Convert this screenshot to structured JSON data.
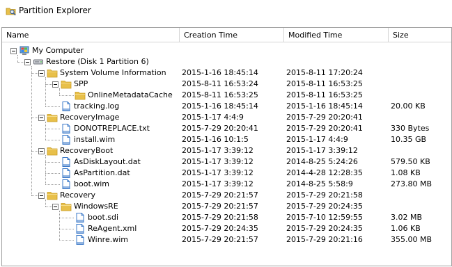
{
  "window": {
    "title": "Partition Explorer",
    "icon": "search-folder-icon"
  },
  "columns": [
    {
      "label": "Name"
    },
    {
      "label": "Creation Time"
    },
    {
      "label": "Modified Time"
    },
    {
      "label": "Size"
    }
  ],
  "rows": [
    {
      "name": "My Computer",
      "level": 0,
      "type": "computer",
      "expanded": true,
      "creation": "",
      "modified": "",
      "size": ""
    },
    {
      "name": "Restore (Disk 1 Partition 6)",
      "level": 1,
      "type": "drive",
      "expanded": true,
      "creation": "",
      "modified": "",
      "size": ""
    },
    {
      "name": "System Volume Information",
      "level": 2,
      "type": "folder",
      "expanded": true,
      "creation": "2015-1-16 18:45:14",
      "modified": "2015-8-11 17:20:24",
      "size": ""
    },
    {
      "name": "SPP",
      "level": 3,
      "type": "folder",
      "expanded": true,
      "creation": "2015-8-11 16:53:24",
      "modified": "2015-8-11 16:53:25",
      "size": ""
    },
    {
      "name": "OnlineMetadataCache",
      "level": 4,
      "type": "folder",
      "expanded": false,
      "creation": "2015-8-11 16:53:25",
      "modified": "2015-8-11 16:53:25",
      "size": ""
    },
    {
      "name": "tracking.log",
      "level": 3,
      "type": "file",
      "expanded": false,
      "creation": "2015-1-16 18:45:14",
      "modified": "2015-1-16 18:45:14",
      "size": "20.00 KB"
    },
    {
      "name": "RecoveryImage",
      "level": 2,
      "type": "folder",
      "expanded": true,
      "creation": "2015-1-17 4:4:9",
      "modified": "2015-7-29 20:20:41",
      "size": ""
    },
    {
      "name": "DONOTREPLACE.txt",
      "level": 3,
      "type": "file",
      "expanded": false,
      "creation": "2015-7-29 20:20:41",
      "modified": "2015-7-29 20:20:41",
      "size": "330 Bytes"
    },
    {
      "name": "install.wim",
      "level": 3,
      "type": "file",
      "expanded": false,
      "creation": "2015-1-16 10:1:5",
      "modified": "2015-1-17 4:4:9",
      "size": "10.35 GB"
    },
    {
      "name": "RecoveryBoot",
      "level": 2,
      "type": "folder",
      "expanded": true,
      "creation": "2015-1-17 3:39:12",
      "modified": "2015-1-17 3:39:12",
      "size": ""
    },
    {
      "name": "AsDiskLayout.dat",
      "level": 3,
      "type": "file",
      "expanded": false,
      "creation": "2015-1-17 3:39:12",
      "modified": "2014-8-25 5:24:26",
      "size": "579.50 KB"
    },
    {
      "name": "AsPartition.dat",
      "level": 3,
      "type": "file",
      "expanded": false,
      "creation": "2015-1-17 3:39:12",
      "modified": "2014-4-28 12:28:35",
      "size": "1.08 KB"
    },
    {
      "name": "boot.wim",
      "level": 3,
      "type": "file",
      "expanded": false,
      "creation": "2015-1-17 3:39:12",
      "modified": "2014-8-25 5:58:9",
      "size": "273.80 MB"
    },
    {
      "name": "Recovery",
      "level": 2,
      "type": "folder",
      "expanded": true,
      "creation": "2015-7-29 20:21:57",
      "modified": "2015-7-29 20:21:58",
      "size": ""
    },
    {
      "name": "WindowsRE",
      "level": 3,
      "type": "folder",
      "expanded": true,
      "creation": "2015-7-29 20:21:57",
      "modified": "2015-7-29 20:24:35",
      "size": ""
    },
    {
      "name": "boot.sdi",
      "level": 4,
      "type": "file",
      "expanded": false,
      "creation": "2015-7-29 20:21:58",
      "modified": "2015-7-10 12:59:55",
      "size": "3.02 MB"
    },
    {
      "name": "ReAgent.xml",
      "level": 4,
      "type": "file",
      "expanded": false,
      "creation": "2015-7-29 20:24:35",
      "modified": "2015-7-29 20:24:35",
      "size": "1.06 KB"
    },
    {
      "name": "Winre.wim",
      "level": 4,
      "type": "file",
      "expanded": false,
      "creation": "2015-7-29 20:21:57",
      "modified": "2015-7-29 20:21:16",
      "size": "355.00 MB"
    }
  ],
  "colors": {
    "folder": "#e8c04a",
    "folder_dark": "#c89a1e",
    "file": "#ffffff",
    "file_accent": "#3a78c8",
    "tree_line": "#9a9a9a",
    "header_border": "#a0a0a0"
  }
}
